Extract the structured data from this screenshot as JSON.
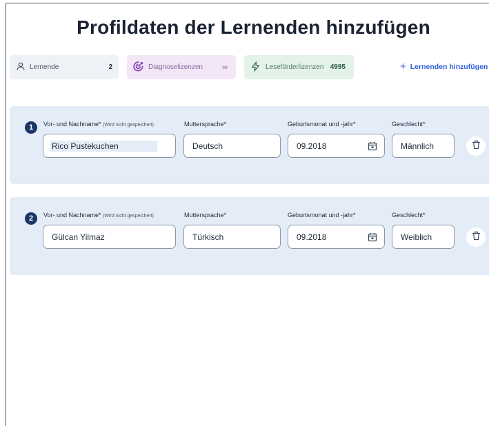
{
  "page": {
    "title": "Profildaten der Lernenden hinzufügen"
  },
  "stats": {
    "lernende": {
      "label": "Lernende",
      "count": "2",
      "icon": "user-icon"
    },
    "diagnose": {
      "label": "Diagnoselizenzen",
      "count": "∞",
      "icon": "target-icon"
    },
    "lesefoerder": {
      "label": "Leseförderlizenzen",
      "count": "4995",
      "icon": "lightning-icon"
    }
  },
  "actions": {
    "add_learner": "Lernenden hinzufügen"
  },
  "labels": {
    "name": "Vor- und Nachname*",
    "name_note": "(Wird nicht gespeichert)",
    "language": "Muttersprache*",
    "birth": "Geburtsmonat und -jahr*",
    "gender": "Geschlecht*"
  },
  "learners": [
    {
      "number": "1",
      "name": "Rico Pustekuchen",
      "language": "Deutsch",
      "birth": "09.2018",
      "gender": "Männlich"
    },
    {
      "number": "2",
      "name": "Gülcan Yilmaz",
      "language": "Türkisch",
      "birth": "09.2018",
      "gender": "Weiblich"
    }
  ],
  "colors": {
    "accent": "#2d5fd8",
    "card_bg": "#e4ecf8",
    "badge": "#1b3667"
  }
}
